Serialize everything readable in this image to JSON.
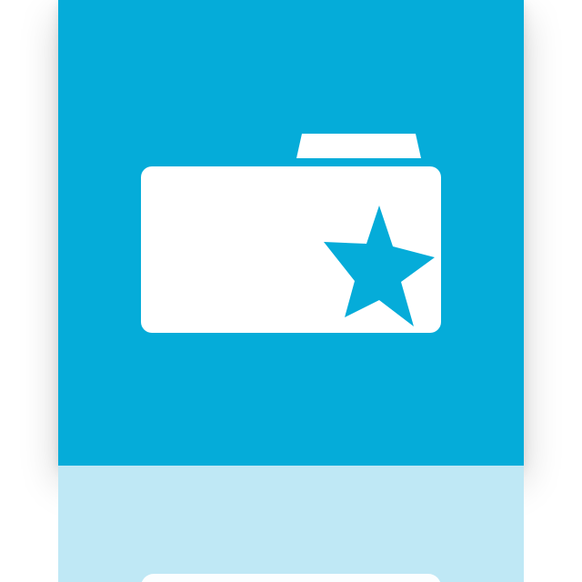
{
  "tile": {
    "background_color": "#05acd9",
    "reflection_color": "#bfe8f5",
    "foreground_color": "#ffffff"
  },
  "icon": {
    "name": "favorite-folder-icon",
    "parts": [
      "folder-icon",
      "star-icon"
    ]
  }
}
